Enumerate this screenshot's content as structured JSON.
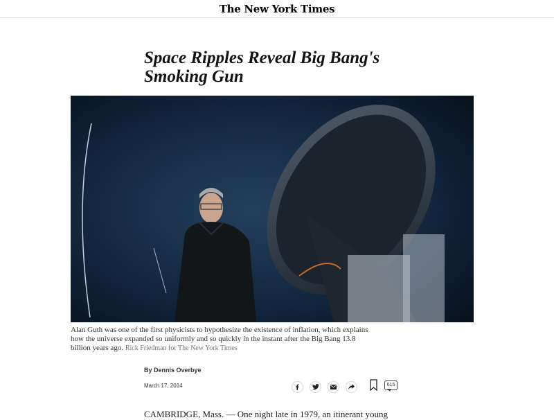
{
  "masthead": {
    "logo_text": "The New York Times"
  },
  "article": {
    "headline": "Space Ripples Reveal Big Bang's Smoking Gun",
    "caption": "Alan Guth was one of the first physicists to hypothesize the existence of inflation, which explains how the universe expanded so uniformly and so quickly in the instant after the Big Bang 13.8 billion years ago.",
    "caption_credit": "Rick Friedman for The New York Times",
    "byline": "By Dennis Overbye",
    "date": "March 17, 2014",
    "first_line": "CAMBRIDGE, Mass. — One night late in 1979, an itinerant young"
  },
  "share": {
    "comment_count": "615",
    "icons": [
      "facebook-icon",
      "twitter-icon",
      "email-icon",
      "share-arrow-icon",
      "bookmark-icon",
      "comment-icon"
    ]
  }
}
